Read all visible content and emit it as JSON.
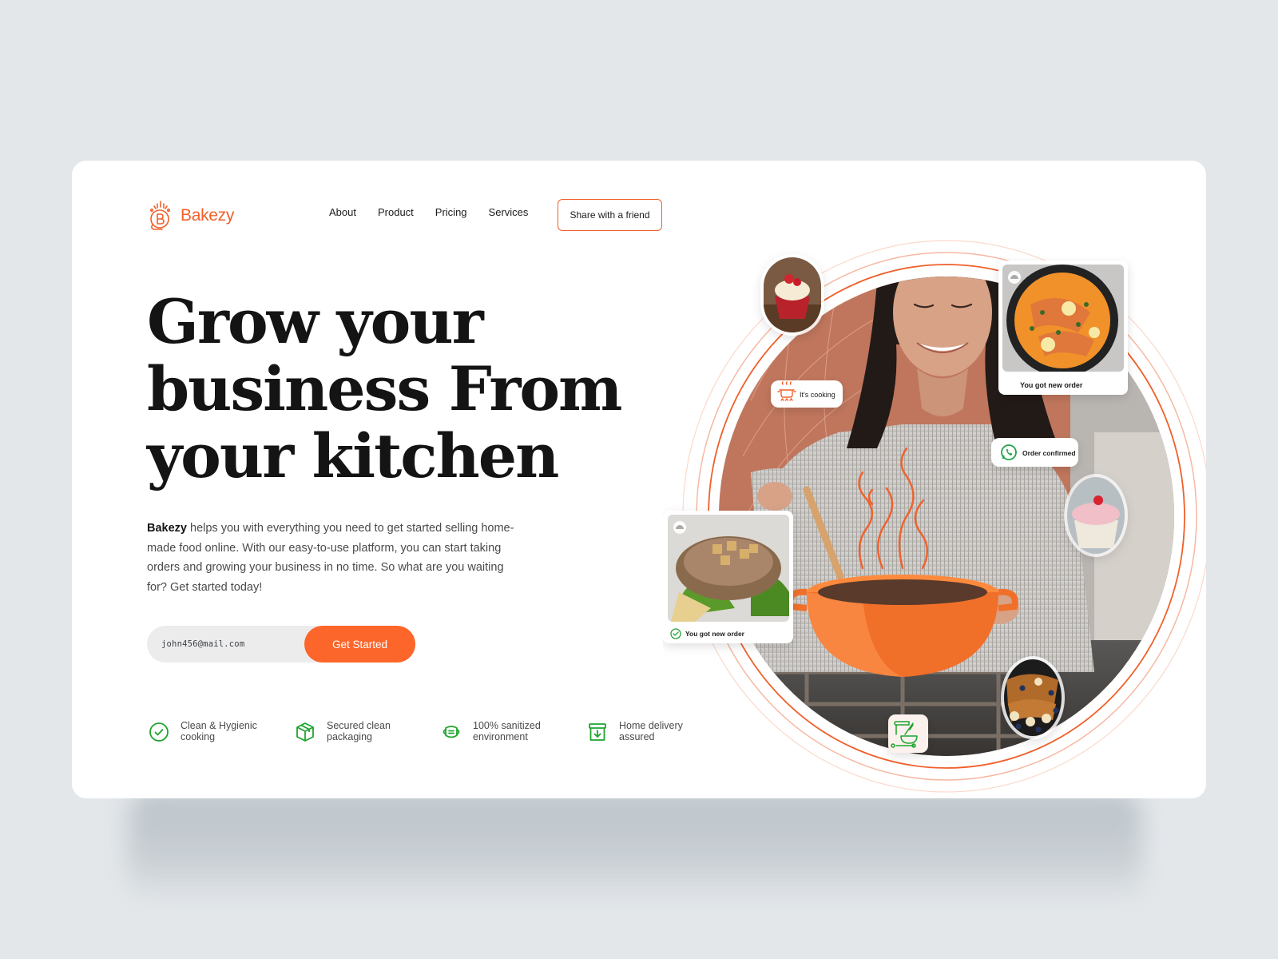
{
  "brand": {
    "name": "Bakezy",
    "accent": "#f0602a",
    "cta_color": "#fd662b",
    "feature_icon_color": "#1fa42d"
  },
  "nav": {
    "items": [
      {
        "label": "About"
      },
      {
        "label": "Product"
      },
      {
        "label": "Pricing"
      },
      {
        "label": "Services"
      }
    ],
    "share_button": "Share with a friend"
  },
  "hero": {
    "headline_lines": [
      "Grow your",
      "business From",
      "your kitchen"
    ],
    "description_brand": "Bakezy",
    "description_rest": " helps you with everything you need to get started selling home-made food online. With our easy-to-use platform, you can start taking orders and growing your business in no time. So what are you waiting for? Get started today!",
    "email_value": "john456@mail.com",
    "cta_label": "Get Started"
  },
  "features": [
    {
      "icon": "check-circle-icon",
      "label": "Clean & Hygienic cooking"
    },
    {
      "icon": "package-box-icon",
      "label": "Secured clean packaging"
    },
    {
      "icon": "face-mask-icon",
      "label": "100% sanitized environment"
    },
    {
      "icon": "delivery-box-icon",
      "label": "Home delivery assured"
    }
  ],
  "visual": {
    "badges": {
      "cooking": "It's cooking",
      "order_confirmed": "Order confirmed",
      "new_order_top": "You got new order",
      "new_order_left": "You got new order"
    },
    "icons": [
      "cooking-pot-icon",
      "whatsapp-icon",
      "check-circle-icon",
      "baking-tools-icon",
      "cloche-icon"
    ],
    "photos": [
      "woman-cooking",
      "red-velvet-cupcake",
      "salmon-curry-pan",
      "pork-chop-plate",
      "frosted-cupcake",
      "french-toast-blueberries"
    ]
  }
}
